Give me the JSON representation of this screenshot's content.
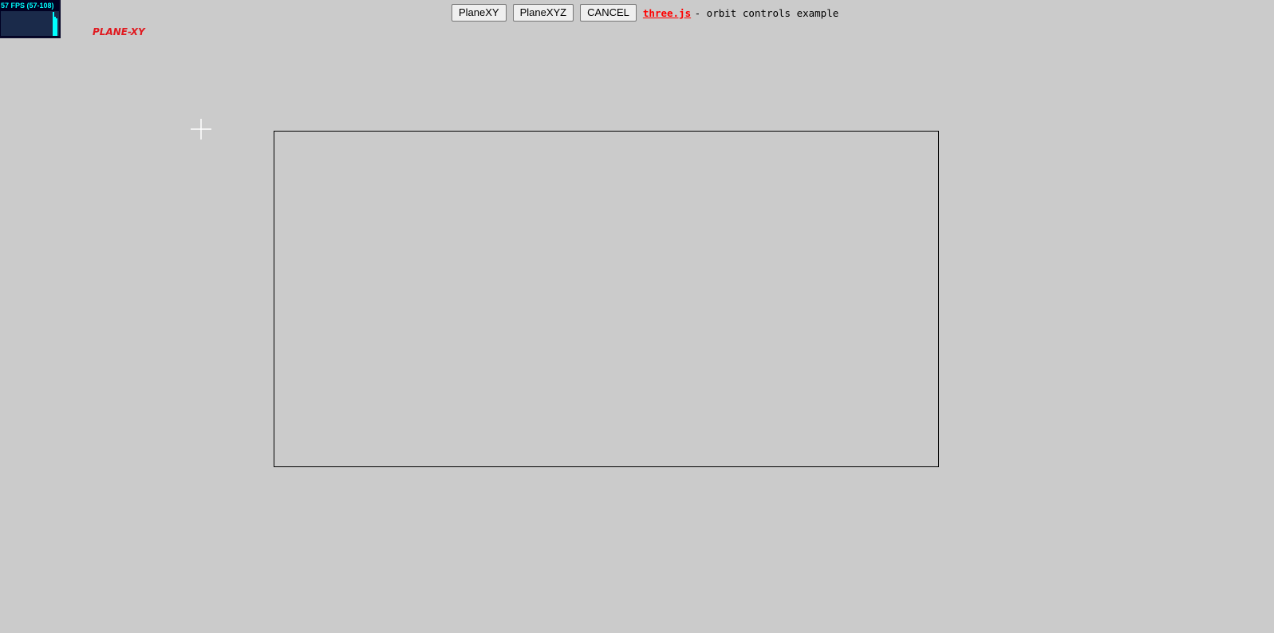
{
  "stats": {
    "fps_text": "57 FPS (57-108)",
    "fps_current": 57,
    "fps_min": 57,
    "fps_max": 108,
    "text_color": "#00ffff",
    "background_color": "#000022"
  },
  "mode_label": "PLANE-XY",
  "mode_label_color": "#e0191f",
  "toolbar": {
    "plane_xy_label": "PlaneXY",
    "plane_xyz_label": "PlaneXYZ",
    "cancel_label": "CANCEL"
  },
  "info": {
    "link_text": "three.js",
    "description": " - orbit controls example",
    "link_color": "#ff0000"
  },
  "canvas": {
    "background_color": "#cbcbcb",
    "cursor_icon": "crosshair-icon"
  }
}
